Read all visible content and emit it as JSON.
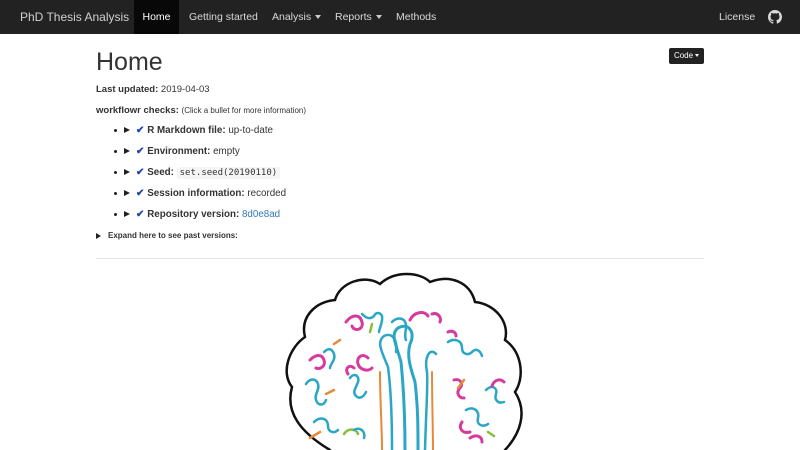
{
  "navbar": {
    "brand": "PhD Thesis Analysis",
    "items": [
      {
        "label": "Home",
        "active": true
      },
      {
        "label": "Getting started"
      },
      {
        "label": "Analysis",
        "dropdown": true
      },
      {
        "label": "Reports",
        "dropdown": true
      },
      {
        "label": "Methods"
      }
    ],
    "right": [
      {
        "label": "License"
      }
    ],
    "github_icon": "github-icon"
  },
  "page": {
    "title": "Home",
    "code_button": "Code",
    "last_updated_label": "Last updated:",
    "last_updated_value": "2019-04-03",
    "checks_label": "workflowr checks:",
    "checks_hint": "(Click a bullet for more information)",
    "checks": [
      {
        "label": "R Markdown file:",
        "value": "up-to-date"
      },
      {
        "label": "Environment:",
        "value": "empty"
      },
      {
        "label": "Seed:",
        "value": "set.seed(20190110)"
      },
      {
        "label": "Session information:",
        "value": "recorded"
      },
      {
        "label": "Repository version:",
        "value": "8d0e8ad"
      }
    ],
    "expand_label": "Expand here to see past versions:"
  },
  "colors": {
    "navbar_bg": "#222222",
    "link": "#337ab7",
    "check": "#2044b0"
  }
}
